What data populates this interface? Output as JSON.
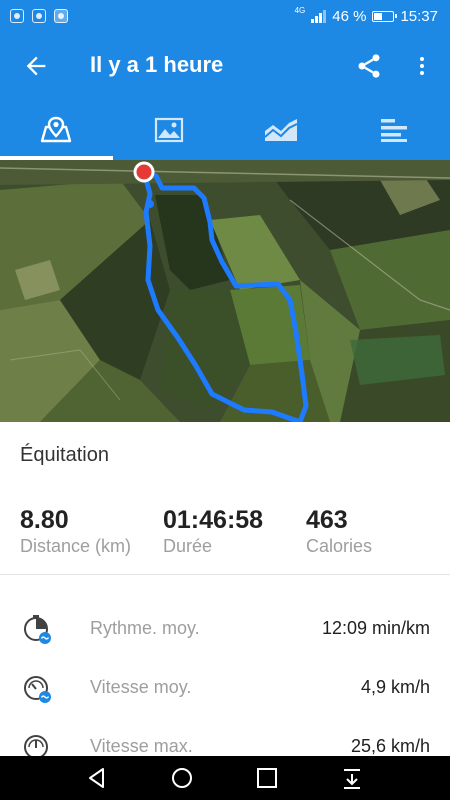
{
  "status_bar": {
    "network": "4G",
    "battery_percent": "46 %",
    "time": "15:37",
    "battery_level": 0.46
  },
  "app_bar": {
    "title": "Il y a 1 heure",
    "back_icon": "arrow-back-icon",
    "share_icon": "share-icon",
    "more_icon": "more-vertical-icon"
  },
  "tabs": [
    {
      "icon": "map-icon",
      "active": true
    },
    {
      "icon": "photo-icon",
      "active": false
    },
    {
      "icon": "chart-icon",
      "active": false
    },
    {
      "icon": "bar-list-icon",
      "active": false
    }
  ],
  "activity": {
    "name": "Équitation"
  },
  "stats": [
    {
      "value": "8.80",
      "label": "Distance (km)"
    },
    {
      "value": "01:46:58",
      "label": "Durée"
    },
    {
      "value": "463",
      "label": "Calories"
    }
  ],
  "details": [
    {
      "icon": "pace-icon",
      "label": "Rythme. moy.",
      "value": "12:09 min/km"
    },
    {
      "icon": "speedometer-icon",
      "label": "Vitesse moy.",
      "value": "4,9 km/h"
    },
    {
      "icon": "speedometer-max-icon",
      "label": "Vitesse max.",
      "value": "25,6 km/h"
    }
  ],
  "nav_bar": {
    "back_icon": "nav-back-icon",
    "home_icon": "nav-home-icon",
    "recent_icon": "nav-recent-icon",
    "notification_icon": "nav-notification-icon"
  },
  "colors": {
    "primary": "#1e88e5",
    "route": "#1e7bff",
    "start_marker": "#e53935"
  }
}
